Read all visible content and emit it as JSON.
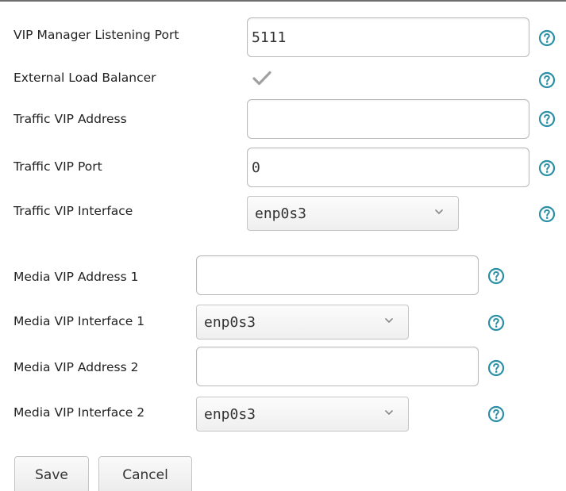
{
  "form": {
    "vip_manager_port": {
      "label": "VIP Manager Listening Port",
      "value": "5111",
      "placeholder": ""
    },
    "external_lb": {
      "label": "External Load Balancer",
      "checked": true
    },
    "traffic_vip_address": {
      "label": "Traffic VIP Address",
      "value": "",
      "placeholder": ""
    },
    "traffic_vip_port": {
      "label": "Traffic VIP Port",
      "value": "0",
      "placeholder": ""
    },
    "traffic_vip_interface": {
      "label": "Traffic VIP Interface",
      "selected": "enp0s3"
    },
    "media_vip_address_1": {
      "label": "Media VIP Address 1",
      "value": "",
      "placeholder": ""
    },
    "media_vip_interface_1": {
      "label": "Media VIP Interface 1",
      "selected": "enp0s3"
    },
    "media_vip_address_2": {
      "label": "Media VIP Address 2",
      "value": "",
      "placeholder": ""
    },
    "media_vip_interface_2": {
      "label": "Media VIP Interface 2",
      "selected": "enp0s3"
    }
  },
  "buttons": {
    "save_label": "Save",
    "cancel_label": "Cancel"
  },
  "icons": {
    "help": "help-circle-icon",
    "checkmark": "checkmark-icon",
    "dropdown": "chevron-down-icon"
  },
  "colors": {
    "help_icon": "#2b8fa5",
    "checkmark_disabled": "#9a9a9a",
    "border": "#b9b9b9"
  }
}
